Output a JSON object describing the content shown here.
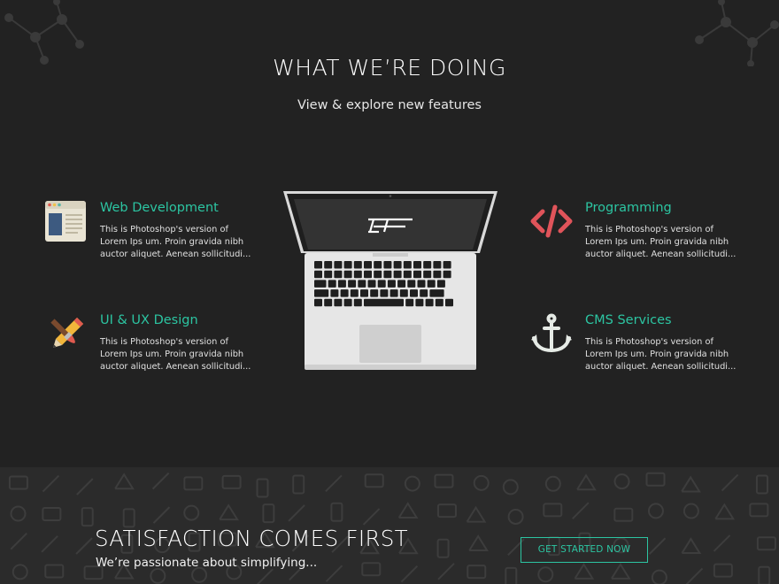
{
  "section": {
    "title": "WHAT WE’RE DOING",
    "subtitle": "View & explore new features"
  },
  "features": [
    {
      "title": "Web Development",
      "text": "This is Photoshop's version of Lorem Ips um. Proin gravida nibh auctor aliquet. Aenean sollicitudi...",
      "icon": "browser-window-icon"
    },
    {
      "title": "UI & UX Design",
      "text": "This is Photoshop's version of Lorem Ips um. Proin gravida nibh auctor aliquet. Aenean sollicitudi...",
      "icon": "pencil-brush-icon"
    },
    {
      "title": "Programming",
      "text": "This is Photoshop's version of Lorem Ips um. Proin gravida nibh auctor aliquet. Aenean sollicitudi...",
      "icon": "code-brackets-icon"
    },
    {
      "title": "CMS Services",
      "text": "This is Photoshop's version of Lorem Ips um. Proin gravida nibh auctor aliquet. Aenean sollicitudi...",
      "icon": "anchor-icon"
    }
  ],
  "cta": {
    "title": "SATISFACTION COMES FIRST",
    "subtitle": "We’re passionate about simplifying...",
    "button": "GET STARTED NOW"
  },
  "colors": {
    "accent": "#2cc5a2",
    "background": "#222222",
    "band": "#2b2b2b"
  }
}
